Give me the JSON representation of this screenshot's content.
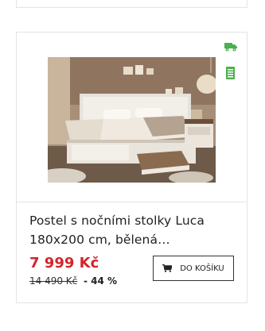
{
  "product": {
    "title": "Postel s nočními stolky Luca 180x200 cm, bělená…",
    "price": "7 999 Kč",
    "old_price": "14 490 Kč",
    "discount": "- 44 %",
    "cart_label": "DO KOŠÍKU",
    "image_alt": "Postel s nočními stolky Luca"
  },
  "icons": {
    "delivery": "truck-icon",
    "stock": "stock-available-icon",
    "cart": "cart-icon"
  },
  "colors": {
    "price": "#d1262c",
    "icon_green": "#4caf50",
    "border": "#e4e4e4"
  }
}
